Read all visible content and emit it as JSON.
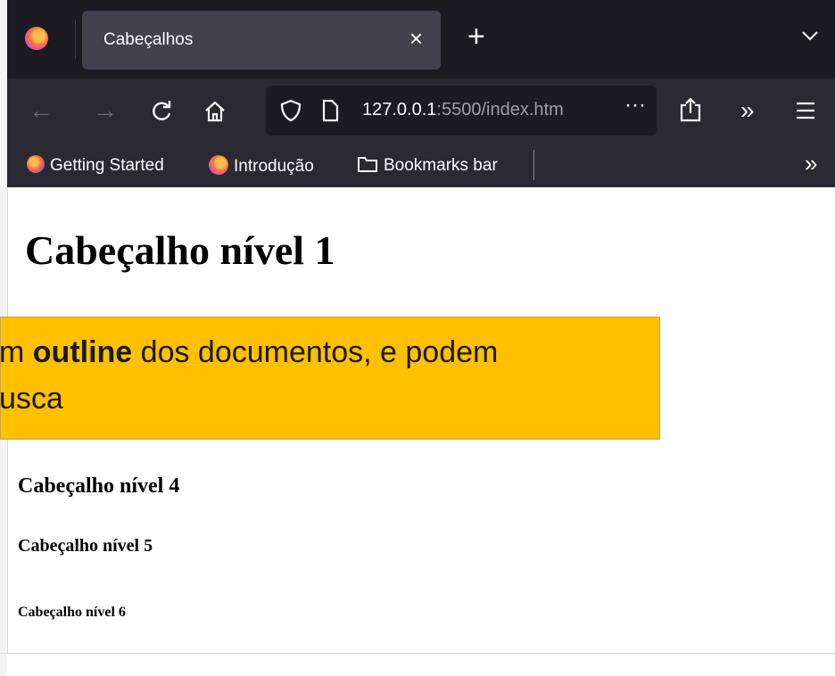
{
  "browser": {
    "tab_title": "Cabeçalhos",
    "tab_close": "×",
    "new_tab": "+",
    "url_host": "127.0.0.1",
    "url_rest": ":5500/index.htm",
    "url_more": "···",
    "bookmarks": [
      {
        "label": "Getting Started",
        "icon": "firefox-icon"
      },
      {
        "label": "Introdução",
        "icon": "firefox-icon"
      },
      {
        "label": "Bookmarks bar",
        "icon": "folder-icon"
      }
    ],
    "overflow": "»"
  },
  "page": {
    "h1": "Cabeçalho nível 1",
    "h4": "Cabeçalho nível 4",
    "h5": "Cabeçalho nível 5",
    "h6": "Cabeçalho nível 6"
  },
  "callout": {
    "line1_pre": "m ",
    "line1_bold": "outline",
    "line1_post": " dos documentos, e podem",
    "line2": "usca",
    "color": "#ffc000"
  }
}
